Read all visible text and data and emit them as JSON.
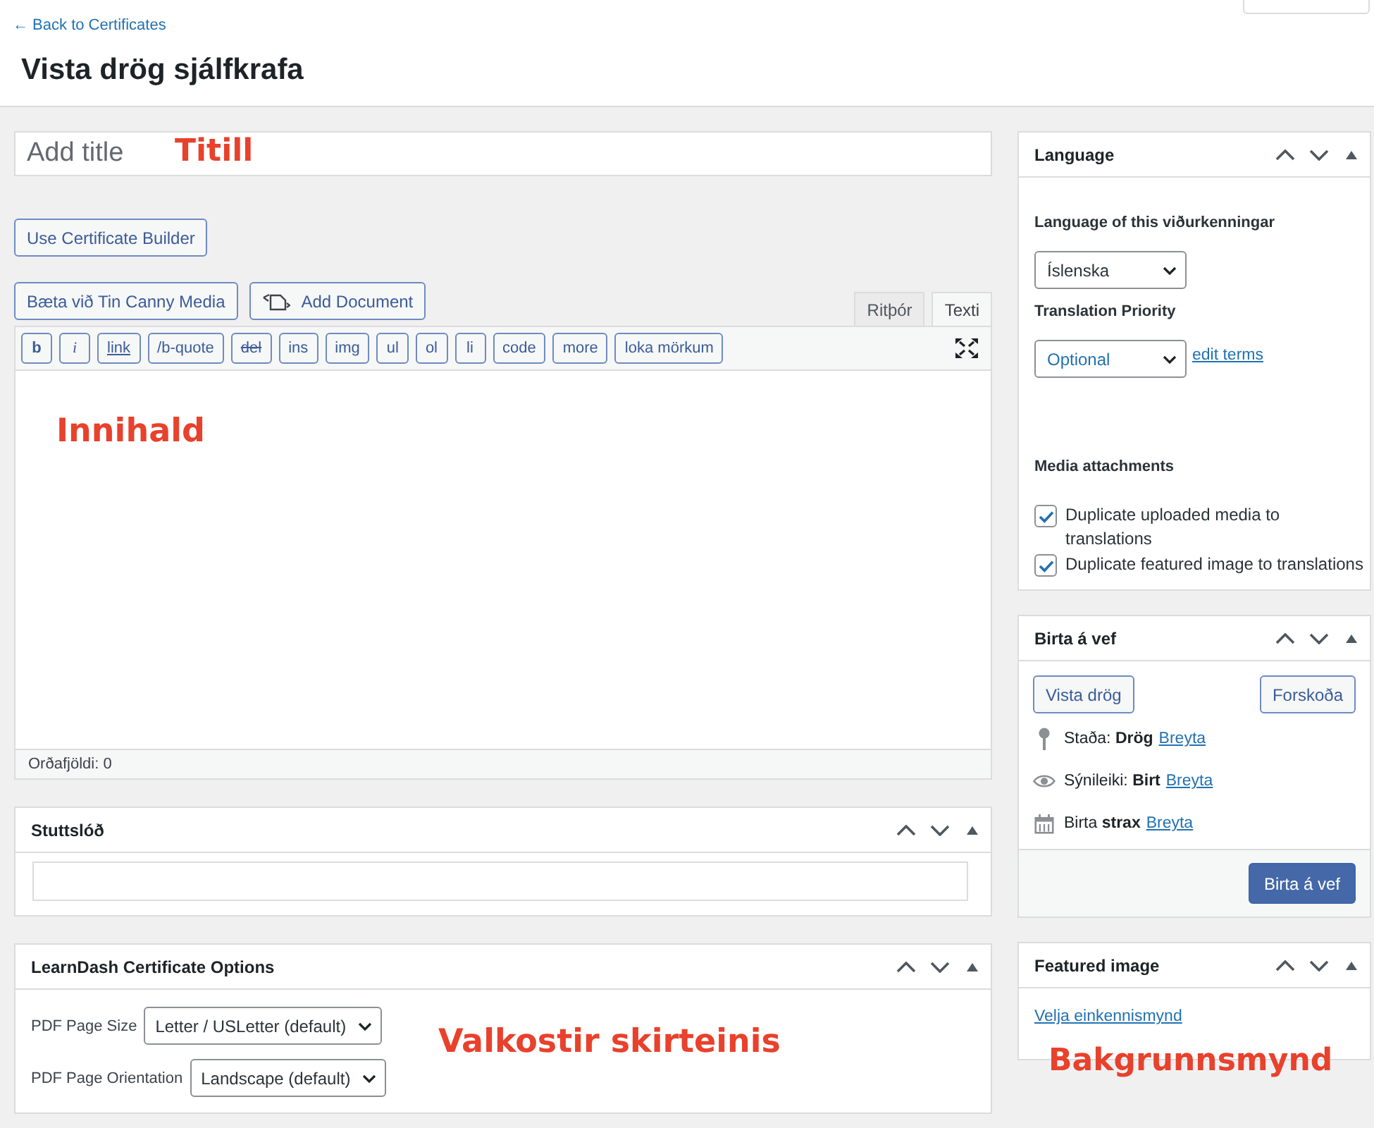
{
  "header": {
    "back_link": "← Back to Certificates",
    "title": "Vista drög sjálfkrafa"
  },
  "title_field": {
    "placeholder": "Add title",
    "annotation": "Titill"
  },
  "builder_button": "Use Certificate Builder",
  "media_buttons": [
    {
      "label": "Bæta við Tin Canny Media",
      "kind": "plain"
    },
    {
      "label": "Add Document",
      "kind": "document"
    }
  ],
  "editor_tabs": [
    {
      "label": "Ritþór",
      "selected": false
    },
    {
      "label": "Texti",
      "selected": true
    }
  ],
  "quicktags": [
    {
      "label": "b",
      "kind": "bold"
    },
    {
      "label": "i",
      "kind": "italic"
    },
    {
      "label": "link",
      "kind": "link"
    },
    {
      "label": "/b-quote",
      "kind": "plain"
    },
    {
      "label": "del",
      "kind": "strike"
    },
    {
      "label": "ins",
      "kind": "plain"
    },
    {
      "label": "img",
      "kind": "plain"
    },
    {
      "label": "ul",
      "kind": "plain"
    },
    {
      "label": "ol",
      "kind": "plain"
    },
    {
      "label": "li",
      "kind": "plain"
    },
    {
      "label": "code",
      "kind": "plain"
    },
    {
      "label": "more",
      "kind": "plain"
    },
    {
      "label": "loka mörkum",
      "kind": "plain"
    }
  ],
  "editor": {
    "annotation": "Innihald",
    "word_count": "Orðafjöldi: 0"
  },
  "slug_panel": {
    "title": "Stuttslóð"
  },
  "certificate_options": {
    "title": "LearnDash Certificate Options",
    "fields": [
      {
        "label": "PDF Page Size",
        "value": "Letter / USLetter (default)"
      },
      {
        "label": "PDF Page Orientation",
        "value": "Landscape (default)"
      }
    ],
    "annotation": "Valkostir skirteinis"
  },
  "language_panel": {
    "title": "Language",
    "language_label": "Language of this viðurkenningar",
    "language_value": "Íslenska",
    "priority_label": "Translation Priority",
    "priority_value": "Optional",
    "edit_link": "edit terms",
    "media_heading": "Media attachments",
    "options": [
      {
        "label": "Duplicate uploaded media to translations",
        "checked": true
      },
      {
        "label": "Duplicate featured image to translations",
        "checked": true
      }
    ]
  },
  "publish_panel": {
    "title": "Birta á vef",
    "save_button": "Vista drög",
    "preview_button": "Forskoða",
    "rows": [
      {
        "kind": "status",
        "text": "Staða: **Drög**",
        "link": "Breyta"
      },
      {
        "kind": "visibility",
        "text": "Sýnileiki: **Birt**",
        "link": "Breyta"
      },
      {
        "kind": "schedule",
        "text": "Birta **strax**",
        "link": "Breyta"
      }
    ],
    "publish_button": "Birta á vef"
  },
  "featured_image_panel": {
    "title": "Featured image",
    "link": "Velja einkennismynd",
    "annotation": "Bakgrunnsmynd"
  }
}
